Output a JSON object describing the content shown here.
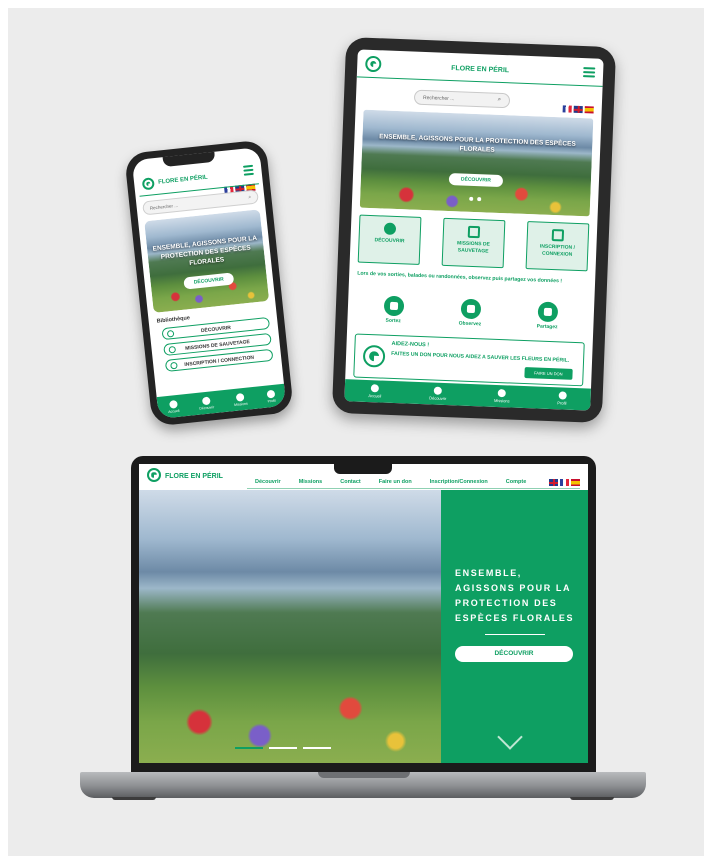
{
  "brand": {
    "name": "FLORE EN PÉRIL",
    "accent": "#0e9f62"
  },
  "tablet": {
    "title": "FLORE EN PÉRIL",
    "search_placeholder": "Rechercher ...",
    "hero_text": "ENSEMBLE, AGISSONS POUR LA PROTECTION DES ESPÈCES FLORALES",
    "hero_button": "DÉCOUVRIR",
    "cards": [
      {
        "label": "DÉCOUVRIR",
        "icon": "info-icon"
      },
      {
        "label": "MISSIONS DE SAUVETAGE",
        "icon": "lifebuoy-icon"
      },
      {
        "label": "INSCRIPTION / CONNEXION",
        "icon": "login-icon"
      }
    ],
    "paragraph": "Lors de vos sorties, balades ou randonnées, observez puis partagez vos données !",
    "actions": [
      {
        "label": "Sortez",
        "icon": "hiker-icon"
      },
      {
        "label": "Observez",
        "icon": "camera-icon"
      },
      {
        "label": "Partagez",
        "icon": "laptop-icon"
      }
    ],
    "donation": {
      "title": "AIDEZ-NOUS !",
      "text": "FAITES UN DON POUR NOUS AIDEZ A SAUVER LES FLEURS EN PÉRIL.",
      "button": "FAIRE UN DON"
    },
    "nav": [
      {
        "label": "Accueil",
        "icon": "home-icon"
      },
      {
        "label": "Découvrir",
        "icon": "info-icon"
      },
      {
        "label": "Missions",
        "icon": "lifebuoy-icon"
      },
      {
        "label": "Profil",
        "icon": "user-icon"
      }
    ]
  },
  "phone": {
    "title": "FLORE EN PÉRIL",
    "search_placeholder": "Rechercher ...",
    "hero_text": "ENSEMBLE, AGISSONS POUR LA PROTECTION DES ESPÈCES FLORALES",
    "hero_button": "DÉCOUVRIR",
    "library_label": "Bibliothèque",
    "buttons": [
      {
        "label": "DÉCOUVRIR",
        "icon": "info-icon"
      },
      {
        "label": "MISSIONS DE SAUVETAGE",
        "icon": "lifebuoy-icon"
      },
      {
        "label": "INSCRIPTION / CONNECTION",
        "icon": "login-icon"
      }
    ],
    "nav": [
      {
        "label": "Accueil",
        "icon": "home-icon"
      },
      {
        "label": "Découvrir",
        "icon": "info-icon"
      },
      {
        "label": "Missions",
        "icon": "lifebuoy-icon"
      },
      {
        "label": "Profil",
        "icon": "user-icon"
      }
    ]
  },
  "laptop": {
    "brand": "FLORE EN PÉRIL",
    "menu": [
      "Découvrir",
      "Missions",
      "Contact",
      "Faire un don",
      "Inscription/Connexion",
      "Compte"
    ],
    "hero_text": "ENSEMBLE, AGISSONS POUR LA PROTECTION DES ESPÈCES FLORALES",
    "hero_button": "DÉCOUVRIR"
  }
}
